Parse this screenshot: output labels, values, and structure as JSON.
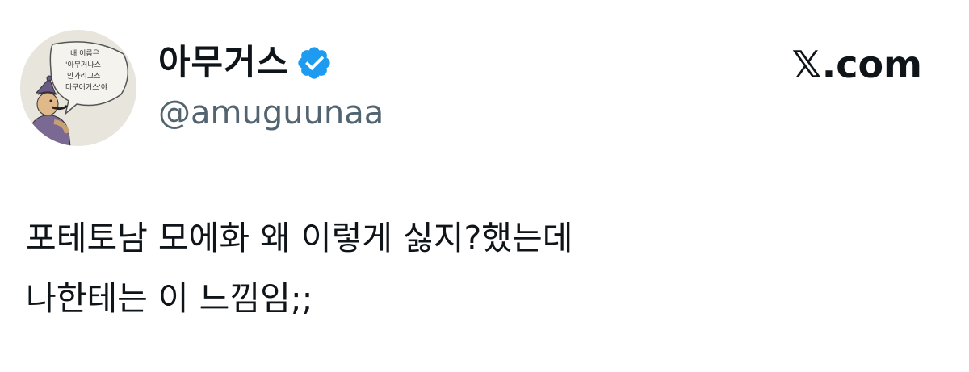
{
  "author": {
    "display_name": "아무거스",
    "handle": "@amuguunaa",
    "verified": true,
    "avatar_caption": [
      "내 이름은",
      "'아무거나스",
      "안가리고스",
      "다구어거스'야"
    ]
  },
  "brand": {
    "label": "𝕏.com"
  },
  "tweet": {
    "lines": [
      "포테토남 모에화 왜 이렇게 싫지?했는데",
      "나한테는 이 느낌임;;"
    ]
  },
  "colors": {
    "text": "#0f1419",
    "secondary": "#536471",
    "verified_badge": "#1d9bf0"
  },
  "icons": {
    "verified": "verified-badge-icon",
    "avatar": "cartoon-character-avatar"
  }
}
